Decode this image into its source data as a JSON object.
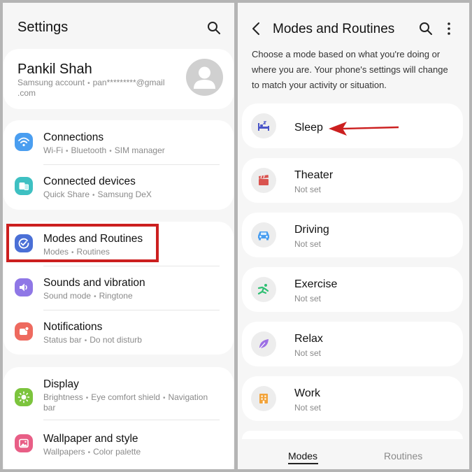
{
  "settings": {
    "title": "Settings",
    "profile": {
      "name": "Pankil Shah",
      "account_label": "Samsung account",
      "email_line1": "pan*********@gmail",
      "email_line2": ".com"
    },
    "items": [
      {
        "title": "Connections",
        "subs": [
          "Wi-Fi",
          "Bluetooth",
          "SIM manager"
        ],
        "icon": "wifi-icon",
        "color": "#4a9ef0"
      },
      {
        "title": "Connected devices",
        "subs": [
          "Quick Share",
          "Samsung DeX"
        ],
        "icon": "devices-icon",
        "color": "#3ec0c2"
      },
      {
        "title": "Modes and Routines",
        "subs": [
          "Modes",
          "Routines"
        ],
        "icon": "modes-check-icon",
        "color": "#4a6fd6"
      },
      {
        "title": "Sounds and vibration",
        "subs": [
          "Sound mode",
          "Ringtone"
        ],
        "icon": "speaker-icon",
        "color": "#8f77e6"
      },
      {
        "title": "Notifications",
        "subs": [
          "Status bar",
          "Do not disturb"
        ],
        "icon": "notification-icon",
        "color": "#ee6a5f"
      },
      {
        "title": "Display",
        "subs": [
          "Brightness",
          "Eye comfort shield",
          "Navigation"
        ],
        "sub2": "bar",
        "icon": "sun-icon",
        "color": "#7cc43d"
      },
      {
        "title": "Wallpaper and style",
        "subs": [
          "Wallpapers",
          "Color palette"
        ],
        "icon": "image-icon",
        "color": "#e85e86"
      }
    ],
    "highlight_color": "#cc1f1f"
  },
  "modes": {
    "title": "Modes and Routines",
    "description": [
      "Choose a mode based on what you're doing or",
      "where you are. Your phone's settings will change",
      "to match your activity or situation."
    ],
    "items": [
      {
        "title": "Sleep",
        "sub": "",
        "icon": "bed-icon",
        "color": "#4a55c8"
      },
      {
        "title": "Theater",
        "sub": "Not set",
        "icon": "clapperboard-icon",
        "color": "#d9534f"
      },
      {
        "title": "Driving",
        "sub": "Not set",
        "icon": "car-icon",
        "color": "#4a9ef0"
      },
      {
        "title": "Exercise",
        "sub": "Not set",
        "icon": "running-icon",
        "color": "#2fbf73"
      },
      {
        "title": "Relax",
        "sub": "Not set",
        "icon": "leaf-icon",
        "color": "#9c6fe4"
      },
      {
        "title": "Work",
        "sub": "Not set",
        "icon": "building-icon",
        "color": "#f2a33a"
      }
    ],
    "tabs": [
      "Modes",
      "Routines"
    ],
    "arrow_color": "#cc1f1f"
  }
}
